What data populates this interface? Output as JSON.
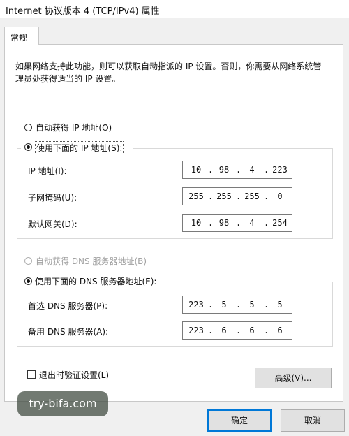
{
  "window": {
    "title": "Internet 协议版本 4 (TCP/IPv4) 属性"
  },
  "tab": {
    "label": "常规"
  },
  "description": "如果网络支持此功能，则可以获取自动指派的 IP 设置。否则，你需要从网络系统管理员处获得适当的 IP 设置。",
  "ip": {
    "auto_label": "自动获得 IP 地址(O)",
    "manual_label": "使用下面的 IP 地址(S):",
    "selected": "manual",
    "fields": [
      {
        "label": "IP 地址(I):",
        "octets": [
          "10",
          "98",
          "4",
          "223"
        ]
      },
      {
        "label": "子网掩码(U):",
        "octets": [
          "255",
          "255",
          "255",
          "0"
        ]
      },
      {
        "label": "默认网关(D):",
        "octets": [
          "10",
          "98",
          "4",
          "254"
        ]
      }
    ]
  },
  "dns": {
    "auto_label": "自动获得 DNS 服务器地址(B)",
    "manual_label": "使用下面的 DNS 服务器地址(E):",
    "auto_enabled": false,
    "selected": "manual",
    "fields": [
      {
        "label": "首选 DNS 服务器(P):",
        "octets": [
          "223",
          "5",
          "5",
          "5"
        ]
      },
      {
        "label": "备用 DNS 服务器(A):",
        "octets": [
          "223",
          "6",
          "6",
          "6"
        ]
      }
    ]
  },
  "validate_checkbox": {
    "label": "退出时验证设置(L)",
    "checked": false
  },
  "buttons": {
    "advanced": "高级(V)...",
    "ok": "确定",
    "cancel": "取消"
  },
  "watermark": "try-bifa.com",
  "colors": {
    "focus_border": "#0078d7",
    "panel_bg": "#ffffff",
    "window_bg": "#f0f0f0"
  }
}
